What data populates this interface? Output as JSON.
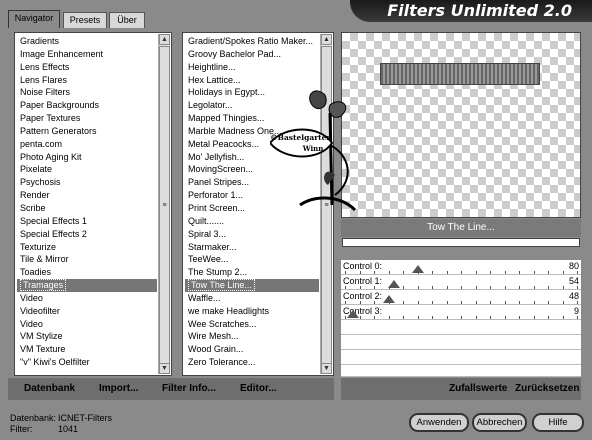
{
  "title": "Filters Unlimited 2.0",
  "tabs": [
    "Navigator",
    "Presets",
    "Über"
  ],
  "categories": [
    "Gradients",
    "Image Enhancement",
    "Lens Effects",
    "Lens Flares",
    "Noise Filters",
    "Paper Backgrounds",
    "Paper Textures",
    "Pattern Generators",
    "penta.com",
    "Photo Aging Kit",
    "Pixelate",
    "Psychosis",
    "Render",
    "Scribe",
    "Special Effects 1",
    "Special Effects 2",
    "Texturize",
    "Tile & Mirror",
    "Toadies",
    "Tramages",
    "Video",
    "Videofilter",
    "Video",
    "VM Stylize",
    "VM Texture",
    "\"v\" Kiwi's Oelfilter"
  ],
  "filters": [
    "Gradient/Spokes Ratio Maker...",
    "Groovy Bachelor Pad...",
    "Heightline...",
    "Hex Lattice...",
    "Holidays in Egypt...",
    "Legolator...",
    "Mapped Thingies...",
    "Marble Madness One...",
    "Metal Peacocks...",
    "Mo' Jellyfish...",
    "MovingScreen...",
    "Panel Stripes...",
    "Perforator 1...",
    "Print Screen...",
    "Quilt.......",
    "Spiral 3...",
    "Starmaker...",
    "TeeWee...",
    "The Stump 2...",
    "Tow The Line...",
    "Waffle...",
    "we make Headlights",
    "Wee Scratches...",
    "Wire Mesh...",
    "Wood Grain...",
    "Zero Tolerance..."
  ],
  "selected_category_index": 19,
  "selected_filter_index": 19,
  "filter_name": "Tow The Line...",
  "controls": [
    {
      "label": "Control 0:",
      "value": "80",
      "level": 80
    },
    {
      "label": "Control 1:",
      "value": "54",
      "level": 54
    },
    {
      "label": "Control 2:",
      "value": "48",
      "level": 48
    },
    {
      "label": "Control 3:",
      "value": "9",
      "level": 9
    }
  ],
  "bottom_left": {
    "datenbank": "Datenbank",
    "import": "Import...",
    "filterinfo": "Filter Info...",
    "editor": "Editor..."
  },
  "bottom_right": {
    "random": "Zufallswerte",
    "reset": "Zurücksetzen"
  },
  "status": {
    "db_label": "Datenbank:",
    "db_value": "ICNET-Filters",
    "filter_label": "Filter:",
    "filter_value": "1041"
  },
  "buttons": {
    "apply": "Anwenden",
    "cancel": "Abbrechen",
    "help": "Hilfe"
  },
  "watermark": {
    "line1": "©Bastelgarten",
    "line2": "Winn"
  }
}
